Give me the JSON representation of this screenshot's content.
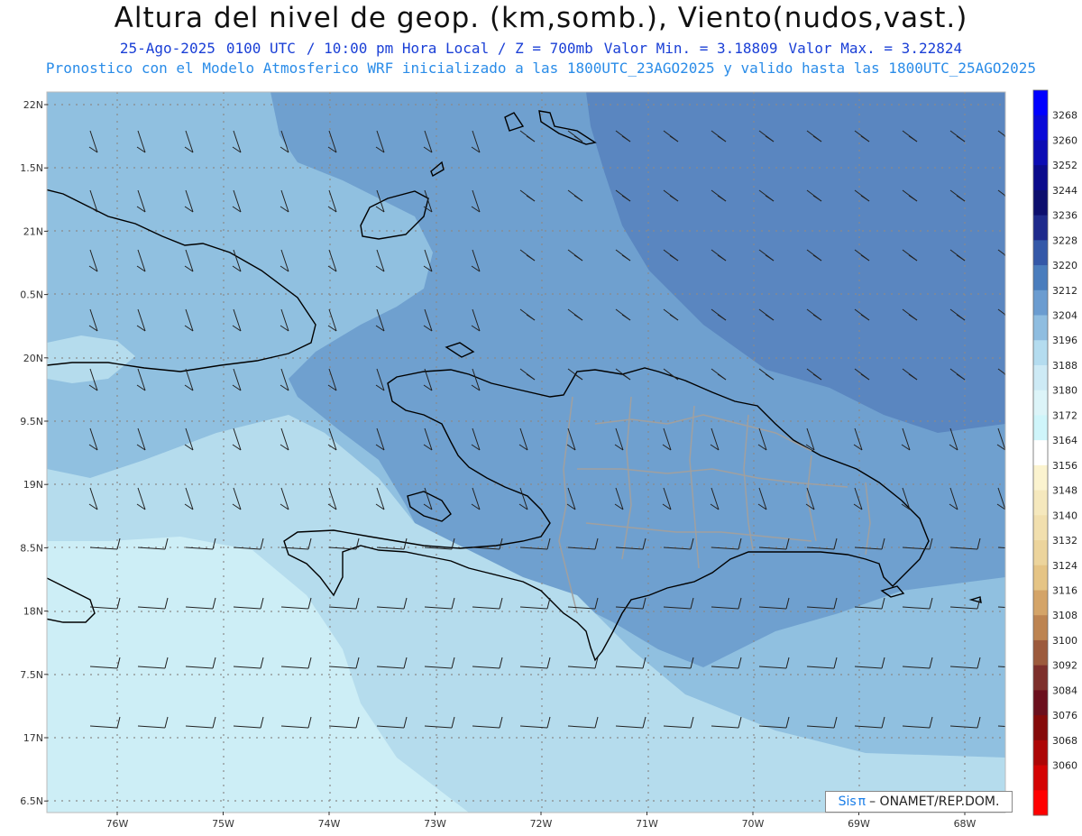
{
  "header": {
    "title": "Altura del nivel de geop. (km,somb.), Viento(nudos,vast.)",
    "date": "25-Ago-2025",
    "utc": "0100 UTC",
    "local": "/ 10:00 pm Hora Local / Z = 700mb",
    "min": "Valor Min. = 3.18809",
    "max": "Valor Max. = 3.22824",
    "model_line": "Pronostico con el Modelo Atmosferico WRF inicializado a las 1800UTC_23AGO2025 y valido hasta las  1800UTC_25AGO2025"
  },
  "axes": {
    "lat_labels": [
      "22N",
      "1.5N",
      "21N",
      "0.5N",
      "20N",
      "9.5N",
      "19N",
      "8.5N",
      "18N",
      "7.5N",
      "17N",
      "6.5N"
    ],
    "lon_labels": [
      "76W",
      "75W",
      "74W",
      "73W",
      "72W",
      "71W",
      "70W",
      "69W",
      "68W"
    ]
  },
  "colorbar": {
    "labels": [
      "3268",
      "3260",
      "3252",
      "3244",
      "3236",
      "3228",
      "3220",
      "3212",
      "3204",
      "3196",
      "3188",
      "3180",
      "3172",
      "3164",
      "3156",
      "3148",
      "3140",
      "3132",
      "3124",
      "3116",
      "3108",
      "3100",
      "3092",
      "3084",
      "3076",
      "3068",
      "3060"
    ],
    "colors": [
      "#0000ff",
      "#0a0ad8",
      "#0c0cb4",
      "#0b0b8c",
      "#0d0f6e",
      "#1e2a8c",
      "#3458a8",
      "#4a7dbd",
      "#6b9cd0",
      "#8fbde0",
      "#b4dcef",
      "#cdeaf5",
      "#dcf4f8",
      "#cff5fa",
      "#ffffff",
      "#fbf3cf",
      "#f5e8bd",
      "#f1dfae",
      "#ecd49c",
      "#e5c485",
      "#d4a468",
      "#bd8451",
      "#9c5a3c",
      "#7d2f2b",
      "#6b0f1d",
      "#850a0a",
      "#ad0606",
      "#d40303",
      "#ff0000"
    ]
  },
  "credit": {
    "sis": "Sis",
    "pi": "π",
    "org": "– ONAMET/REP.DOM."
  },
  "palette": {
    "lightest": "#cdeef6",
    "light": "#b5dced",
    "mid": "#90c0e0",
    "dark": "#6fa0cf",
    "darkest": "#5a86c0"
  }
}
